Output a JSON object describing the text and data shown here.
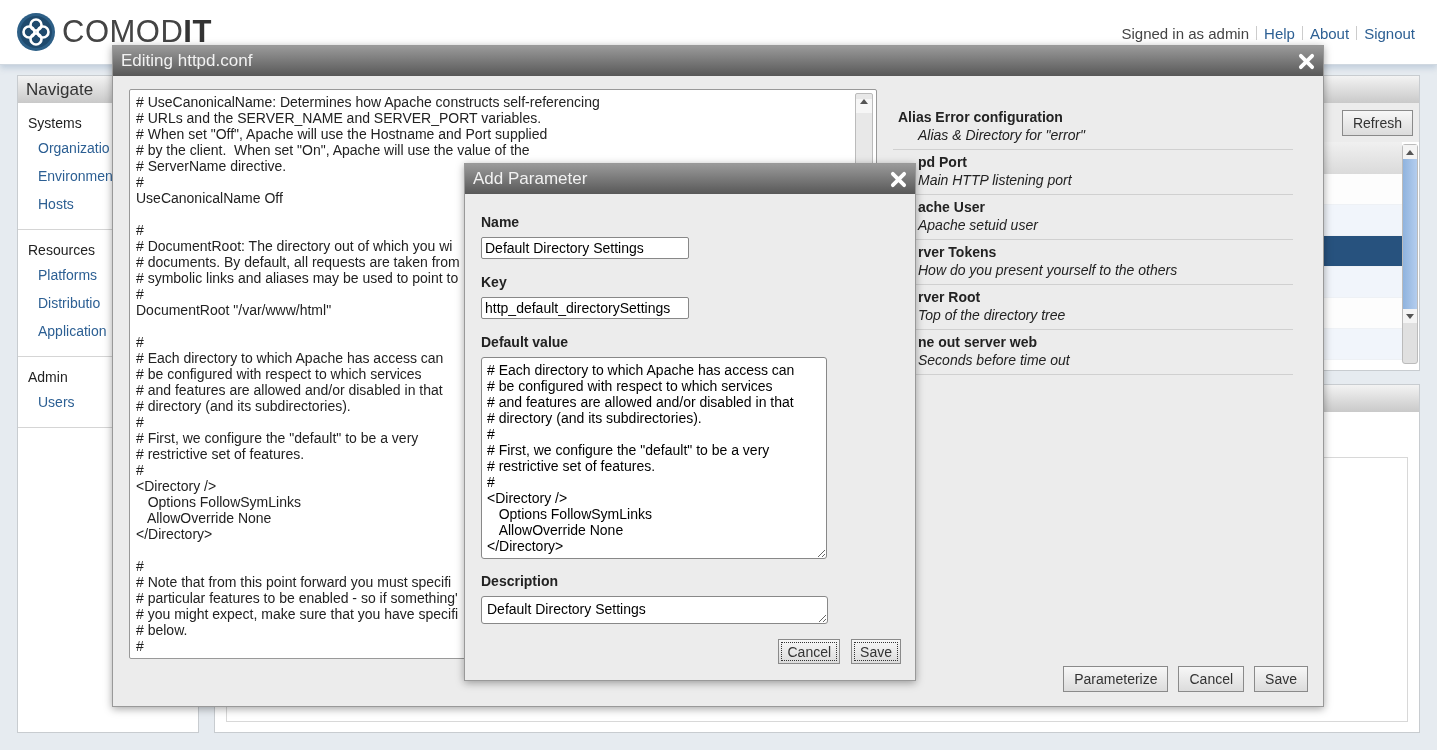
{
  "header": {
    "logo": "COMOD**IT**",
    "user": "Signed in as admin",
    "links": [
      "Help",
      "About",
      "Signout"
    ]
  },
  "sidebar": {
    "title": "Navigate",
    "sections": [
      {
        "label": "Systems",
        "items": [
          "Organizatio",
          "Environmen",
          "Hosts"
        ]
      },
      {
        "label": "Resources",
        "items": [
          "Platforms",
          "Distributio",
          "Application"
        ]
      },
      {
        "label": "Admin",
        "items": [
          "Users"
        ]
      }
    ]
  },
  "main_panel": {
    "button": "Refresh",
    "rows": [
      {
        "selected": false
      },
      {
        "selected": false
      },
      {
        "selected": true
      },
      {
        "selected": false
      },
      {
        "selected": false
      },
      {
        "selected": false
      }
    ]
  },
  "editor_dialog": {
    "title": "Editing httpd.conf",
    "blocks": [
      [
        "# UseCanonicalName: Determines how Apache constructs self-referencing",
        "# URLs and the SERVER_NAME and SERVER_PORT variables.",
        "# When set \"Off\", Apache will use the Hostname and Port supplied",
        "# by the client.  When set \"On\", Apache will use the value of the",
        "# ServerName directive.",
        "#",
        "UseCanonicalName Off"
      ],
      [
        "#",
        "# DocumentRoot: The directory out of which you wi",
        "# documents. By default, all requests are taken from",
        "# symbolic links and aliases may be used to point to",
        "#",
        "DocumentRoot \"/var/www/html\""
      ],
      [
        "#",
        "# Each directory to which Apache has access can",
        "# be configured with respect to which services",
        "# and features are allowed and/or disabled in that",
        "# directory (and its subdirectories).",
        "#",
        "# First, we configure the \"default\" to be a very",
        "# restrictive set of features.",
        "#",
        "<Directory />",
        "   Options FollowSymLinks",
        "   AllowOverride None",
        "</Directory>"
      ],
      [
        "#",
        "# Note that from this point forward you must specifi",
        "# particular features to be enabled - so if something'",
        "# you might expect, make sure that you have specifi",
        "# below.",
        "#"
      ]
    ],
    "parameters": [
      {
        "name": "Alias Error configuration",
        "description": "Alias & Directory for \"error\"",
        "kind": "full"
      },
      {
        "name": "pd Port",
        "description": "Main HTTP listening port",
        "kind": "clipped"
      },
      {
        "name": "ache User",
        "description": "Apache setuid user",
        "kind": "clipped"
      },
      {
        "name": "rver Tokens",
        "description": "How do you present yourself to the others",
        "kind": "clipped"
      },
      {
        "name": "rver Root",
        "description": "Top of the directory tree",
        "kind": "clipped"
      },
      {
        "name": "ne out server web",
        "description": "Seconds before time out",
        "kind": "clipped"
      }
    ],
    "buttons": [
      "Parameterize",
      "Cancel",
      "Save"
    ]
  },
  "add_parameter_dialog": {
    "title": "Add Parameter",
    "fields": [
      {
        "label": "Name",
        "value": "Default Directory Settings",
        "kind": "input"
      },
      {
        "label": "Key",
        "value": "http_default_directorySettings",
        "kind": "input"
      },
      {
        "label": "Default value",
        "value": "# Each directory to which Apache has access can\n# be configured with respect to which services\n# and features are allowed and/or disabled in that\n# directory (and its subdirectories).\n#\n# First, we configure the \"default\" to be a very\n# restrictive set of features.\n#\n<Directory />\n   Options FollowSymLinks\n   AllowOverride None\n</Directory>",
        "kind": "textarea"
      },
      {
        "label": "Description",
        "value": "Default Directory Settings",
        "kind": "textline"
      }
    ],
    "buttons": [
      "Cancel",
      "Save"
    ]
  }
}
